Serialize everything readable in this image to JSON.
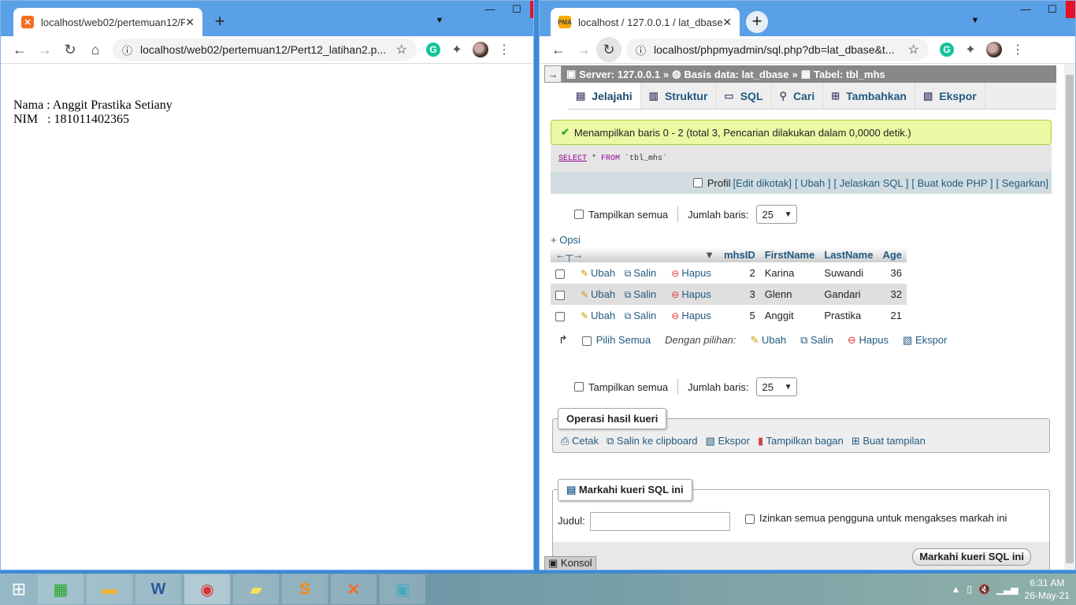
{
  "left_window": {
    "tab_title": "localhost/web02/pertemuan12/P",
    "url": "localhost/web02/pertemuan12/Pert12_latihan2.p...",
    "page": {
      "nama_line": "Nama : Anggit Prastika Setiany",
      "nim_line": "NIM   : 181011402365"
    }
  },
  "right_window": {
    "tab_title": "localhost / 127.0.0.1 / lat_dbase /",
    "url": "localhost/phpmyadmin/sql.php?db=lat_dbase&t...",
    "breadcrumb": {
      "server": "Server: 127.0.0.1",
      "database": "Basis data: lat_dbase",
      "table": "Tabel: tbl_mhs"
    },
    "tabs": [
      "Jelajahi",
      "Struktur",
      "SQL",
      "Cari",
      "Tambahkan",
      "Ekspor"
    ],
    "success_message": "Menampilkan baris 0 - 2 (total 3, Pencarian dilakukan dalam 0,0000 detik.)",
    "sql": {
      "select": "SELECT",
      "rest": " * ",
      "from": "FROM",
      "table": " `tbl_mhs`"
    },
    "profile_bar": {
      "profil": "Profil",
      "links": [
        "[Edit dikotak]",
        "[ Ubah ]",
        "[ Jelaskan SQL ]",
        "[ Buat kode PHP ]",
        "[ Segarkan]"
      ]
    },
    "nav_controls": {
      "show_all": "Tampilkan semua",
      "rows_label": "Jumlah baris:",
      "rows_value": "25"
    },
    "opsi_link": "+ Opsi",
    "table": {
      "columns": [
        "mhsID",
        "FirstName",
        "LastName",
        "Age"
      ],
      "actions": {
        "edit": "Ubah",
        "copy": "Salin",
        "delete": "Hapus"
      },
      "rows": [
        {
          "mhsID": "2",
          "FirstName": "Karina",
          "LastName": "Suwandi",
          "Age": "36"
        },
        {
          "mhsID": "3",
          "FirstName": "Glenn",
          "LastName": "Gandari",
          "Age": "32"
        },
        {
          "mhsID": "5",
          "FirstName": "Anggit",
          "LastName": "Prastika",
          "Age": "21"
        }
      ]
    },
    "bulk": {
      "select_all": "Pilih Semua",
      "with_selected": "Dengan pilihan:",
      "edit": "Ubah",
      "copy": "Salin",
      "delete": "Hapus",
      "export": "Ekspor"
    },
    "query_ops": {
      "legend": "Operasi hasil kueri",
      "items": [
        "Cetak",
        "Salin ke clipboard",
        "Ekspor",
        "Tampilkan bagan",
        "Buat tampilan"
      ]
    },
    "bookmark": {
      "legend": "Markahi kueri SQL ini",
      "title_label": "Judul:",
      "allow_all": "Izinkan semua pengguna untuk mengakses markah ini",
      "button": "Markahi kueri SQL ini"
    },
    "console": "Konsol"
  },
  "taskbar": {
    "time": "6:31 AM",
    "date": "26-May-21"
  },
  "colors": {
    "link": "#235a81",
    "success_bg": "#ebf8a4",
    "titlebar": "#5aa0e6"
  }
}
